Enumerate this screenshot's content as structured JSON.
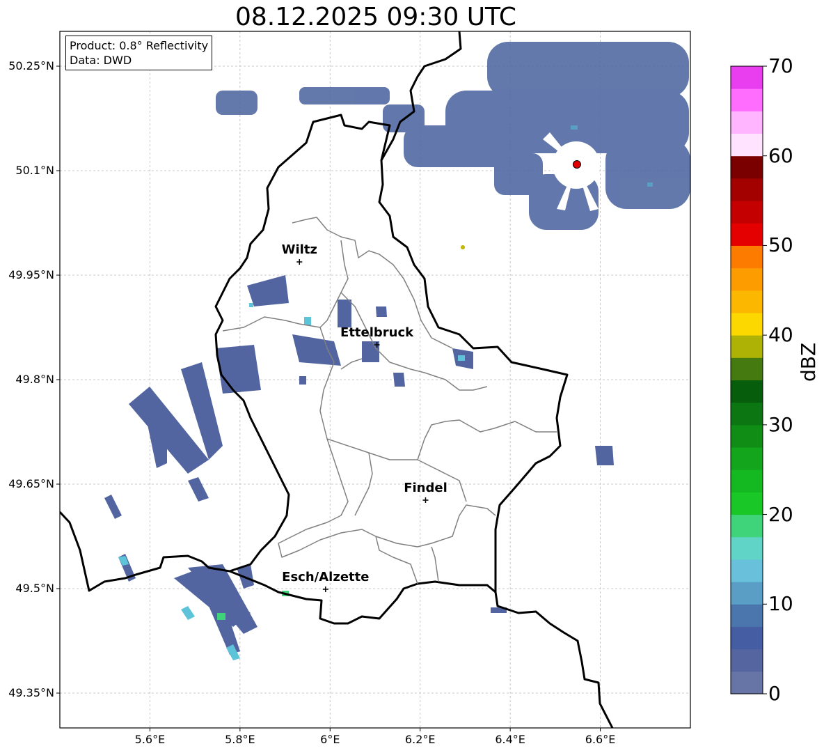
{
  "title": "08.12.2025 09:30 UTC",
  "info": {
    "product": "Product: 0.8° Reflectivity",
    "data": "Data: DWD"
  },
  "map": {
    "lon_range": [
      5.4,
      6.8
    ],
    "lat_range": [
      49.3,
      50.3
    ],
    "xticks": [
      "5.6°E",
      "5.8°E",
      "6°E",
      "6.2°E",
      "6.4°E",
      "6.6°E"
    ],
    "yticks": [
      "50.25°N",
      "50.1°N",
      "49.95°N",
      "49.8°N",
      "49.65°N",
      "49.5°N",
      "49.35°N"
    ],
    "grid": true,
    "radar_site": {
      "lon": 6.548,
      "lat": 50.109,
      "marker_color": "#e00000"
    },
    "cities": [
      {
        "name": "Wiltz",
        "lon": 5.932,
        "lat": 49.969
      },
      {
        "name": "Ettelbruck",
        "lon": 6.104,
        "lat": 49.85
      },
      {
        "name": "Findel",
        "lon": 6.212,
        "lat": 49.627
      },
      {
        "name": "Esch/Alzette",
        "lon": 5.99,
        "lat": 49.499
      }
    ]
  },
  "colorbar": {
    "label": "dBZ",
    "min": 0,
    "max": 70,
    "ticks": [
      "0",
      "10",
      "20",
      "30",
      "40",
      "50",
      "60",
      "70"
    ],
    "colors": [
      "#6675a5",
      "#5565a0",
      "#455ea3",
      "#4b76ad",
      "#5a9ec6",
      "#68c0da",
      "#60d5c7",
      "#3fd47a",
      "#19c826",
      "#14b820",
      "#13a61c",
      "#108d15",
      "#0c7612",
      "#065d0c",
      "#457a10",
      "#adb204",
      "#fdd800",
      "#fcb700",
      "#fd9c00",
      "#fd7c00",
      "#e40000",
      "#c40000",
      "#a30000",
      "#7a0000",
      "#ffe3ff",
      "#ffb5ff",
      "#ff6dff",
      "#e93df0"
    ]
  }
}
